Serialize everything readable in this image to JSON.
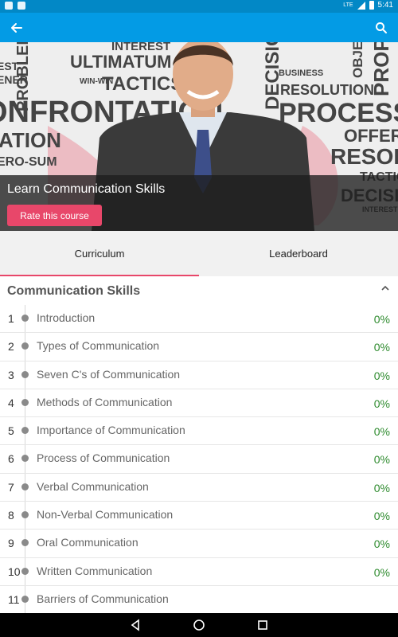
{
  "status_bar": {
    "time": "5:41",
    "network": "LTE"
  },
  "app_bar": {
    "back_icon": "arrow-back-icon",
    "search_icon": "search-icon"
  },
  "banner": {
    "course_title": "Learn Communication Skills",
    "rate_button_label": "Rate this course",
    "background_words": [
      "INTEREST",
      "PROBLEM",
      "ULTIMATUM",
      "WIN-WIN",
      "TACTICS",
      "BUSINESS",
      "RESOLUTION",
      "OBJECTIVE",
      "PROPOSAL",
      "PROCESS",
      "ONFRONTATION",
      "DECISION",
      "OFFER",
      "RESOLUTION",
      "TACTICS",
      "DECISION",
      "INTEREST",
      "ATION",
      "ERO-SUM",
      "ENER",
      "EST"
    ]
  },
  "tabs": [
    {
      "label": "Curriculum",
      "active": true
    },
    {
      "label": "Leaderboard",
      "active": false
    }
  ],
  "section": {
    "title": "Communication Skills",
    "chevron_icon": "chevron-up-icon"
  },
  "lessons": [
    {
      "number": "1",
      "title": "Introduction",
      "progress": "0%"
    },
    {
      "number": "2",
      "title": "Types of Communication",
      "progress": "0%"
    },
    {
      "number": "3",
      "title": "Seven C's of Communication",
      "progress": "0%"
    },
    {
      "number": "4",
      "title": "Methods of Communication",
      "progress": "0%"
    },
    {
      "number": "5",
      "title": "Importance of Communication",
      "progress": "0%"
    },
    {
      "number": "6",
      "title": "Process of Communication",
      "progress": "0%"
    },
    {
      "number": "7",
      "title": "Verbal Communication",
      "progress": "0%"
    },
    {
      "number": "8",
      "title": "Non-Verbal Communication",
      "progress": "0%"
    },
    {
      "number": "9",
      "title": "Oral Communication",
      "progress": "0%"
    },
    {
      "number": "10",
      "title": "Written Communication",
      "progress": "0%"
    },
    {
      "number": "11",
      "title": "Barriers of Communication",
      "progress": ""
    }
  ],
  "colors": {
    "app_bar": "#039be5",
    "status_bar": "#0288c6",
    "accent": "#e8476a",
    "progress": "#2e8b2e"
  },
  "nav_bar": {
    "back_icon": "nav-back-icon",
    "home_icon": "nav-home-icon",
    "recents_icon": "nav-recents-icon"
  }
}
